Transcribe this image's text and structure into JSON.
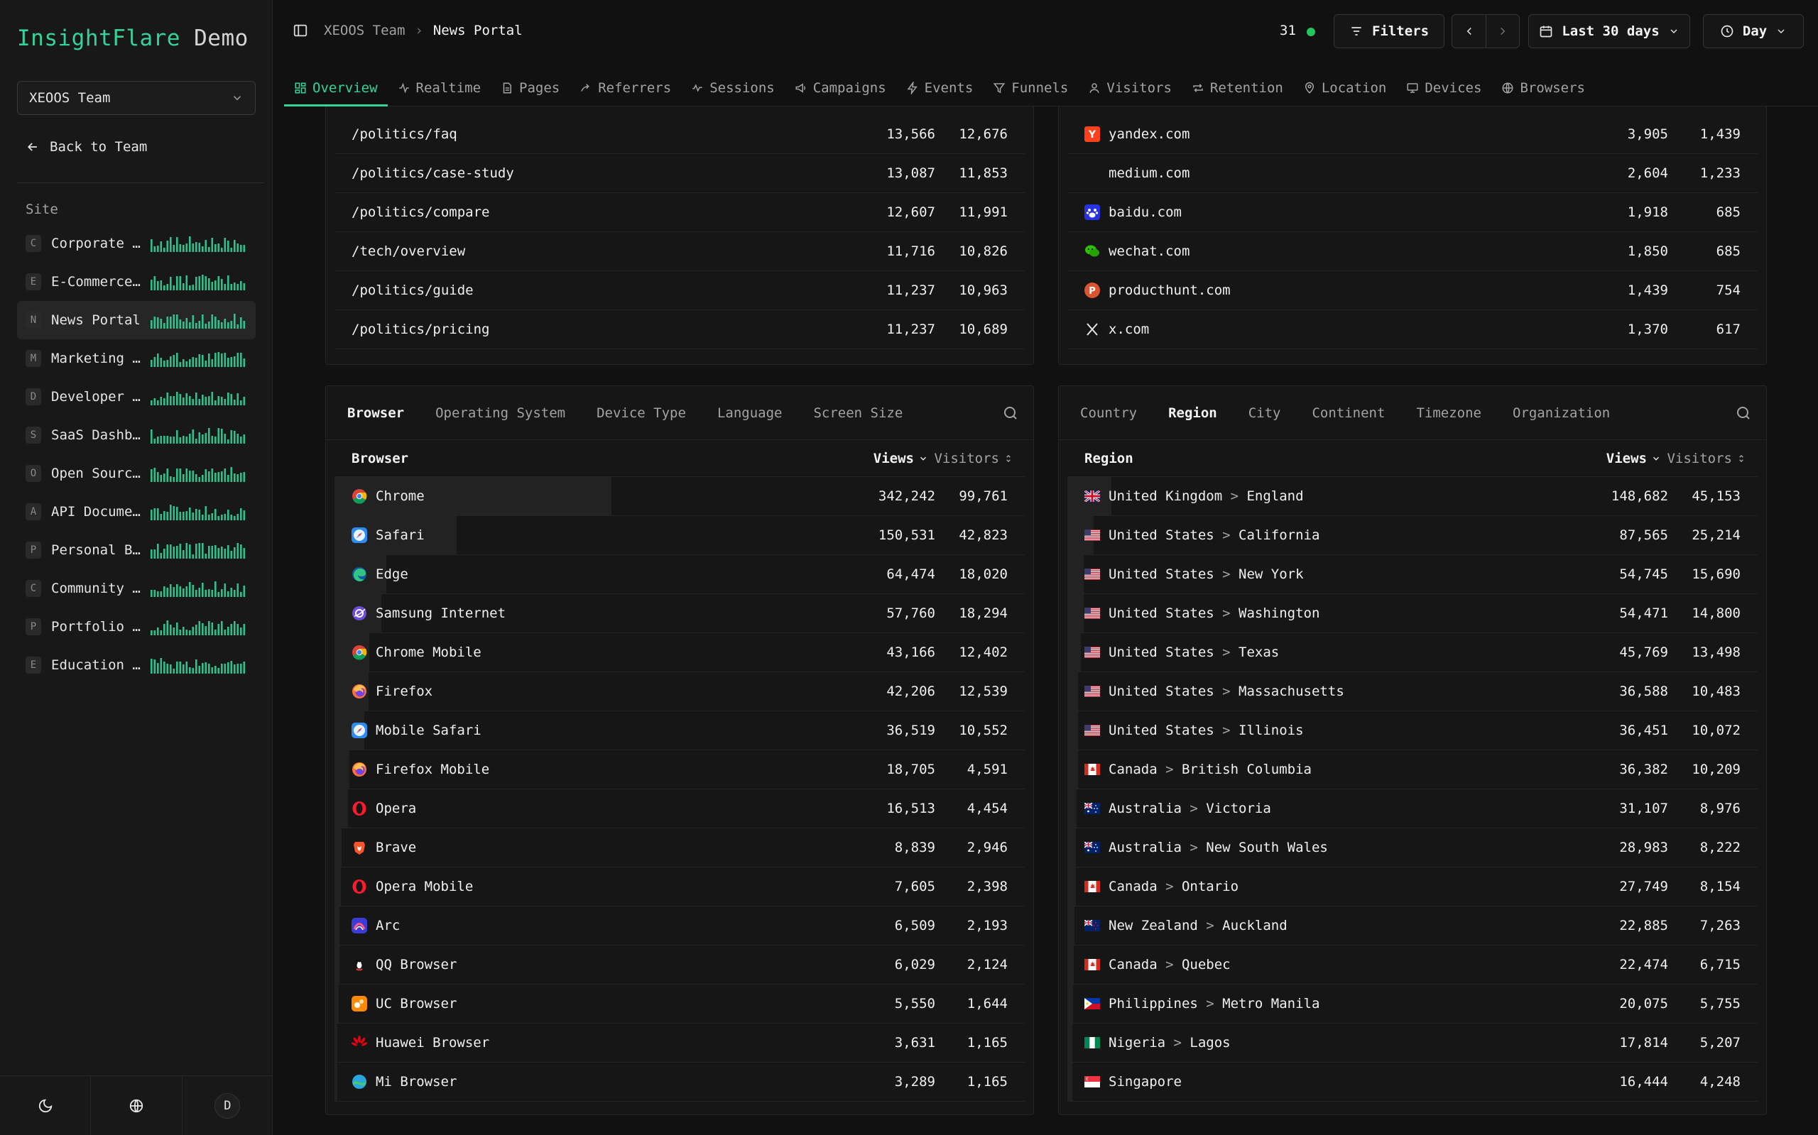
{
  "brand": {
    "name": "InsightFlare",
    "suffix": "Demo"
  },
  "sidebar": {
    "team_select": "XEOOS Team",
    "back_label": "Back to Team",
    "site_label": "Site",
    "sites": [
      {
        "letter": "C",
        "name": "Corporate W…",
        "active": false
      },
      {
        "letter": "E",
        "name": "E-Commerce …",
        "active": false
      },
      {
        "letter": "N",
        "name": "News Portal",
        "active": true
      },
      {
        "letter": "M",
        "name": "Marketing L…",
        "active": false
      },
      {
        "letter": "D",
        "name": "Developer D…",
        "active": false
      },
      {
        "letter": "S",
        "name": "SaaS Dashbo…",
        "active": false
      },
      {
        "letter": "O",
        "name": "Open Source…",
        "active": false
      },
      {
        "letter": "A",
        "name": "API Documen…",
        "active": false
      },
      {
        "letter": "P",
        "name": "Personal Bl…",
        "active": false
      },
      {
        "letter": "C",
        "name": "Community F…",
        "active": false
      },
      {
        "letter": "P",
        "name": "Portfolio S…",
        "active": false
      },
      {
        "letter": "E",
        "name": "Education P…",
        "active": false
      }
    ],
    "avatar_letter": "D"
  },
  "topbar": {
    "breadcrumb_team": "XEOOS Team",
    "breadcrumb_separator": "›",
    "breadcrumb_site": "News Portal",
    "live_count": "31",
    "filters_label": "Filters",
    "date_range_label": "Last 30 days",
    "interval_label": "Day"
  },
  "tabs": [
    {
      "label": "Overview",
      "icon": "grid-icon",
      "active": true
    },
    {
      "label": "Realtime",
      "icon": "activity-icon",
      "active": false
    },
    {
      "label": "Pages",
      "icon": "file-icon",
      "active": false
    },
    {
      "label": "Referrers",
      "icon": "share-icon",
      "active": false
    },
    {
      "label": "Sessions",
      "icon": "pulse-icon",
      "active": false
    },
    {
      "label": "Campaigns",
      "icon": "megaphone-icon",
      "active": false
    },
    {
      "label": "Events",
      "icon": "zap-icon",
      "active": false
    },
    {
      "label": "Funnels",
      "icon": "funnel-icon",
      "active": false
    },
    {
      "label": "Visitors",
      "icon": "user-icon",
      "active": false
    },
    {
      "label": "Retention",
      "icon": "repeat-icon",
      "active": false
    },
    {
      "label": "Location",
      "icon": "pin-icon",
      "active": false
    },
    {
      "label": "Devices",
      "icon": "monitor-icon",
      "active": false
    },
    {
      "label": "Browsers",
      "icon": "globe-icon",
      "active": false
    }
  ],
  "pages_card": {
    "rows": [
      {
        "label": "/politics/faq",
        "views": "13,566",
        "visitors": "12,676"
      },
      {
        "label": "/politics/case-study",
        "views": "13,087",
        "visitors": "11,853"
      },
      {
        "label": "/politics/compare",
        "views": "12,607",
        "visitors": "11,991"
      },
      {
        "label": "/tech/overview",
        "views": "11,716",
        "visitors": "10,826"
      },
      {
        "label": "/politics/guide",
        "views": "11,237",
        "visitors": "10,963"
      },
      {
        "label": "/politics/pricing",
        "views": "11,237",
        "visitors": "10,689"
      }
    ]
  },
  "referrers_card": {
    "rows": [
      {
        "label": "yandex.com",
        "icon": "yandex-icon",
        "views": "3,905",
        "visitors": "1,439"
      },
      {
        "label": "medium.com",
        "icon": "",
        "views": "2,604",
        "visitors": "1,233"
      },
      {
        "label": "baidu.com",
        "icon": "baidu-icon",
        "views": "1,918",
        "visitors": "685"
      },
      {
        "label": "wechat.com",
        "icon": "wechat-icon",
        "views": "1,850",
        "visitors": "685"
      },
      {
        "label": "producthunt.com",
        "icon": "producthunt-icon",
        "views": "1,439",
        "visitors": "754"
      },
      {
        "label": "x.com",
        "icon": "x-icon",
        "views": "1,370",
        "visitors": "617"
      }
    ]
  },
  "browser_card": {
    "tabs": [
      "Browser",
      "Operating System",
      "Device Type",
      "Language",
      "Screen Size"
    ],
    "active_tab": 0,
    "header": {
      "label": "Browser",
      "views": "Views",
      "visitors": "Visitors"
    },
    "rows": [
      {
        "label": "Chrome",
        "icon": "chrome-icon",
        "views": "342,242",
        "visitors": "99,761",
        "share": 1.0
      },
      {
        "label": "Safari",
        "icon": "safari-icon",
        "views": "150,531",
        "visitors": "42,823",
        "share": 0.44
      },
      {
        "label": "Edge",
        "icon": "edge-icon",
        "views": "64,474",
        "visitors": "18,020",
        "share": 0.188
      },
      {
        "label": "Samsung Internet",
        "icon": "samsung-internet-icon",
        "views": "57,760",
        "visitors": "18,294",
        "share": 0.169
      },
      {
        "label": "Chrome Mobile",
        "icon": "chrome-icon",
        "views": "43,166",
        "visitors": "12,402",
        "share": 0.126
      },
      {
        "label": "Firefox",
        "icon": "firefox-icon",
        "views": "42,206",
        "visitors": "12,539",
        "share": 0.123
      },
      {
        "label": "Mobile Safari",
        "icon": "safari-icon",
        "views": "36,519",
        "visitors": "10,552",
        "share": 0.107
      },
      {
        "label": "Firefox Mobile",
        "icon": "firefox-icon",
        "views": "18,705",
        "visitors": "4,591",
        "share": 0.055
      },
      {
        "label": "Opera",
        "icon": "opera-icon",
        "views": "16,513",
        "visitors": "4,454",
        "share": 0.048
      },
      {
        "label": "Brave",
        "icon": "brave-icon",
        "views": "8,839",
        "visitors": "2,946",
        "share": 0.026
      },
      {
        "label": "Opera Mobile",
        "icon": "opera-icon",
        "views": "7,605",
        "visitors": "2,398",
        "share": 0.022
      },
      {
        "label": "Arc",
        "icon": "arc-icon",
        "views": "6,509",
        "visitors": "2,193",
        "share": 0.019
      },
      {
        "label": "QQ Browser",
        "icon": "qq-icon",
        "views": "6,029",
        "visitors": "2,124",
        "share": 0.018
      },
      {
        "label": "UC Browser",
        "icon": "uc-icon",
        "views": "5,550",
        "visitors": "1,644",
        "share": 0.016
      },
      {
        "label": "Huawei Browser",
        "icon": "huawei-icon",
        "views": "3,631",
        "visitors": "1,165",
        "share": 0.011
      },
      {
        "label": "Mi Browser",
        "icon": "mi-icon",
        "views": "3,289",
        "visitors": "1,165",
        "share": 0.01
      }
    ]
  },
  "region_card": {
    "tabs": [
      "Country",
      "Region",
      "City",
      "Continent",
      "Timezone",
      "Organization"
    ],
    "active_tab": 1,
    "header": {
      "label": "Region",
      "views": "Views",
      "visitors": "Visitors"
    },
    "rows": [
      {
        "country": "United Kingdom",
        "region": "England",
        "flag": "uk-flag-icon",
        "views": "148,682",
        "visitors": "45,153",
        "share": 1.0
      },
      {
        "country": "United States",
        "region": "California",
        "flag": "us-flag-icon",
        "views": "87,565",
        "visitors": "25,214",
        "share": 0.589
      },
      {
        "country": "United States",
        "region": "New York",
        "flag": "us-flag-icon",
        "views": "54,745",
        "visitors": "15,690",
        "share": 0.368
      },
      {
        "country": "United States",
        "region": "Washington",
        "flag": "us-flag-icon",
        "views": "54,471",
        "visitors": "14,800",
        "share": 0.366
      },
      {
        "country": "United States",
        "region": "Texas",
        "flag": "us-flag-icon",
        "views": "45,769",
        "visitors": "13,498",
        "share": 0.308
      },
      {
        "country": "United States",
        "region": "Massachusetts",
        "flag": "us-flag-icon",
        "views": "36,588",
        "visitors": "10,483",
        "share": 0.246
      },
      {
        "country": "United States",
        "region": "Illinois",
        "flag": "us-flag-icon",
        "views": "36,451",
        "visitors": "10,072",
        "share": 0.245
      },
      {
        "country": "Canada",
        "region": "British Columbia",
        "flag": "ca-flag-icon",
        "views": "36,382",
        "visitors": "10,209",
        "share": 0.245
      },
      {
        "country": "Australia",
        "region": "Victoria",
        "flag": "au-flag-icon",
        "views": "31,107",
        "visitors": "8,976",
        "share": 0.209
      },
      {
        "country": "Australia",
        "region": "New South Wales",
        "flag": "au-flag-icon",
        "views": "28,983",
        "visitors": "8,222",
        "share": 0.195
      },
      {
        "country": "Canada",
        "region": "Ontario",
        "flag": "ca-flag-icon",
        "views": "27,749",
        "visitors": "8,154",
        "share": 0.187
      },
      {
        "country": "New Zealand",
        "region": "Auckland",
        "flag": "nz-flag-icon",
        "views": "22,885",
        "visitors": "7,263",
        "share": 0.154
      },
      {
        "country": "Canada",
        "region": "Quebec",
        "flag": "ca-flag-icon",
        "views": "22,474",
        "visitors": "6,715",
        "share": 0.151
      },
      {
        "country": "Philippines",
        "region": "Metro Manila",
        "flag": "ph-flag-icon",
        "views": "20,075",
        "visitors": "5,755",
        "share": 0.135
      },
      {
        "country": "Nigeria",
        "region": "Lagos",
        "flag": "ng-flag-icon",
        "views": "17,814",
        "visitors": "5,207",
        "share": 0.12
      },
      {
        "country": "Singapore",
        "region": "",
        "flag": "sg-flag-icon",
        "views": "16,444",
        "visitors": "4,248",
        "share": 0.111
      }
    ]
  },
  "colors": {
    "accent": "#34d399",
    "live": "#22c55e",
    "background": "#111111",
    "card": "#161616"
  }
}
